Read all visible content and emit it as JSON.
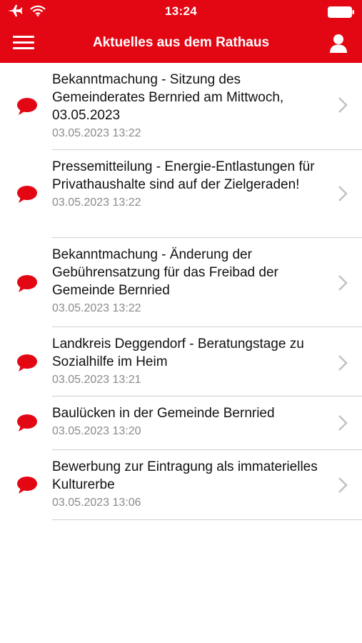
{
  "status_bar": {
    "time": "13:24",
    "icons": [
      "airplane-icon",
      "wifi-icon",
      "battery-icon"
    ]
  },
  "nav": {
    "title": "Aktuelles aus dem Rathaus",
    "menu_icon": "hamburger-menu-icon",
    "profile_icon": "person-icon"
  },
  "colors": {
    "accent": "#e30613",
    "text": "#111111",
    "secondary": "#8a8a8a",
    "divider": "#cfcfcf"
  },
  "news": [
    {
      "title": "Bekanntmachung - Sitzung des Gemeinderates Bernried am Mittwoch, 03.05.2023",
      "date": "03.05.2023 13:22"
    },
    {
      "title": "Pressemitteilung - Energie-Entlastungen für Privathaushalte sind auf der Zielgeraden!",
      "date": "03.05.2023 13:22"
    },
    {
      "title": "Bekanntmachung - Änderung der Gebührensatzung für das Freibad der Gemeinde Bernried",
      "date": "03.05.2023 13:22"
    },
    {
      "title": "Landkreis Deggendorf - Beratungstage zu Sozialhilfe im Heim",
      "date": "03.05.2023 13:21"
    },
    {
      "title": "Baulücken in der Gemeinde Bernried",
      "date": "03.05.2023 13:20"
    },
    {
      "title": "Bewerbung zur Eintragung als immaterielles Kulturerbe",
      "date": "03.05.2023 13:06"
    }
  ]
}
